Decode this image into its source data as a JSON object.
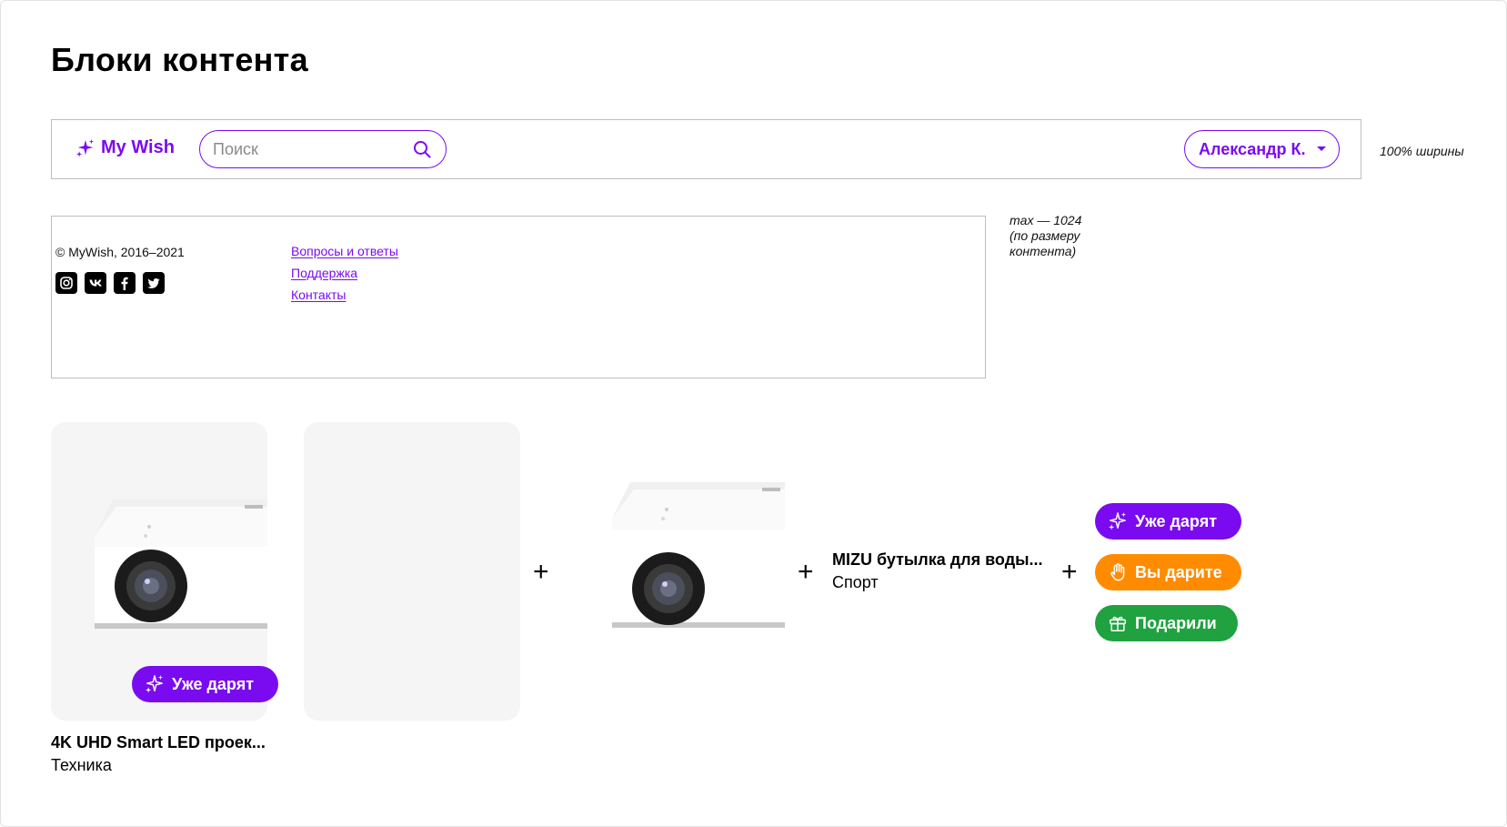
{
  "page": {
    "title": "Блоки контента"
  },
  "header": {
    "logo_text": "My Wish",
    "logo_icon": "sparkle-icon",
    "search_placeholder": "Поиск",
    "user_name": "Александр К.",
    "note": "100% ширины"
  },
  "footer": {
    "copyright": "© MyWish, 2016–2021",
    "socials": [
      "instagram-icon",
      "vk-icon",
      "facebook-icon",
      "twitter-icon"
    ],
    "links": [
      "Вопросы и ответы",
      "Поддержка",
      "Контакты"
    ],
    "note_lines": [
      "max — 1024",
      "(по размеру",
      "контента)"
    ]
  },
  "card": {
    "name": "4K UHD Smart LED проек...",
    "category": "Техника",
    "status_label": "Уже дарят"
  },
  "row": {
    "name": "MIZU бутылка для воды...",
    "category": "Спорт",
    "plus": "+"
  },
  "statuses": [
    {
      "label": "Уже дарят",
      "color": "#7a0bf0",
      "icon": "sparkle-icon"
    },
    {
      "label": "Вы дарите",
      "color": "#ff8c00",
      "icon": "hand-icon"
    },
    {
      "label": "Подарили",
      "color": "#1fa23f",
      "icon": "gift-icon"
    }
  ],
  "colors": {
    "accent": "#7a0bf0",
    "orange": "#ff8c00",
    "green": "#1fa23f",
    "card_bg": "#f5f5f5"
  }
}
